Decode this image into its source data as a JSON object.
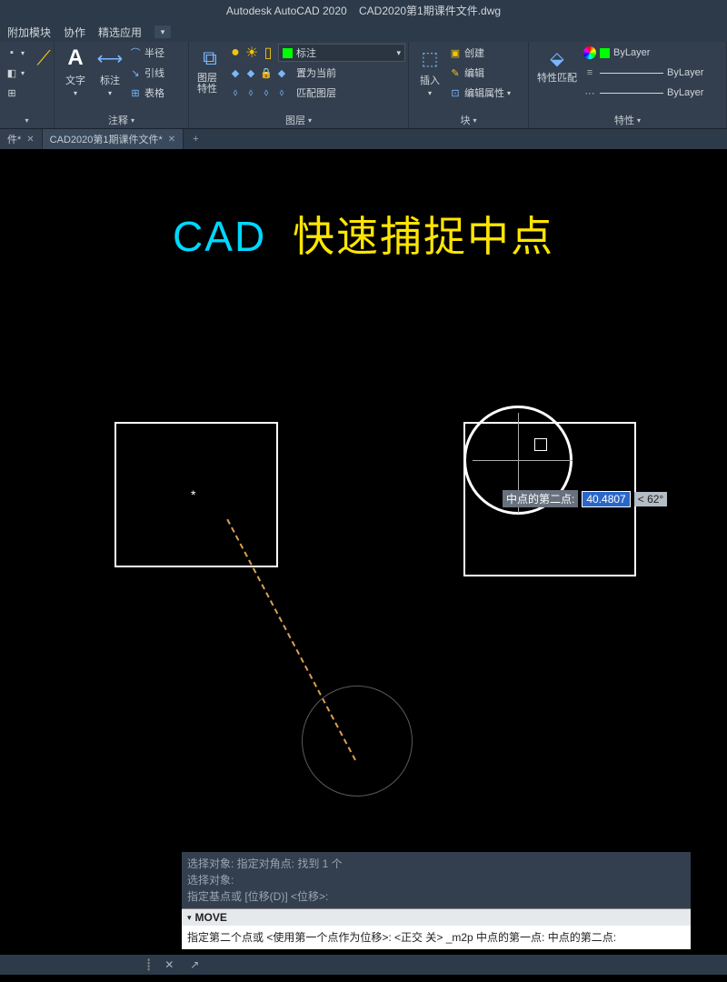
{
  "title": {
    "app": "Autodesk AutoCAD 2020",
    "file": "CAD2020第1期课件文件.dwg"
  },
  "menu": {
    "item1": "附加模块",
    "item2": "协作",
    "item3": "精选应用"
  },
  "ribbon": {
    "annotation": {
      "text": "文字",
      "dim": "标注",
      "radius": "半径",
      "leader": "引线",
      "table": "表格",
      "panel": "注释"
    },
    "layers": {
      "props": "图层特性",
      "dropdown": "标注",
      "setcurrent": "置为当前",
      "match": "匹配图层",
      "panel": "图层"
    },
    "block": {
      "insert": "插入",
      "create": "创建",
      "edit": "编辑",
      "editattr": "编辑属性",
      "panel": "块"
    },
    "props": {
      "match": "特性匹配",
      "layer1": "ByLayer",
      "layer2": "ByLayer",
      "layer3": "ByLayer",
      "panel": "特性"
    }
  },
  "tabs": {
    "tab1": "件*",
    "tab2": "CAD2020第1期课件文件*"
  },
  "canvas": {
    "heading_cad": "CAD",
    "heading_rest": "快速捕捉中点",
    "tooltip_label": "中点的第二点:",
    "tooltip_value": "40.4807",
    "tooltip_angle": "< 62°"
  },
  "cmdline": {
    "hist1": "选择对象: 指定对角点: 找到 1 个",
    "hist2": "选择对象:",
    "hist3": "指定基点或 [位移(D)] <位移>:",
    "cmd_name": "MOVE",
    "body": "指定第二个点或 <使用第一个点作为位移>:  <正交 关> _m2p 中点的第一点: 中点的第二点:"
  },
  "statusbar": {
    "b1": "✕",
    "b2": "↗"
  }
}
